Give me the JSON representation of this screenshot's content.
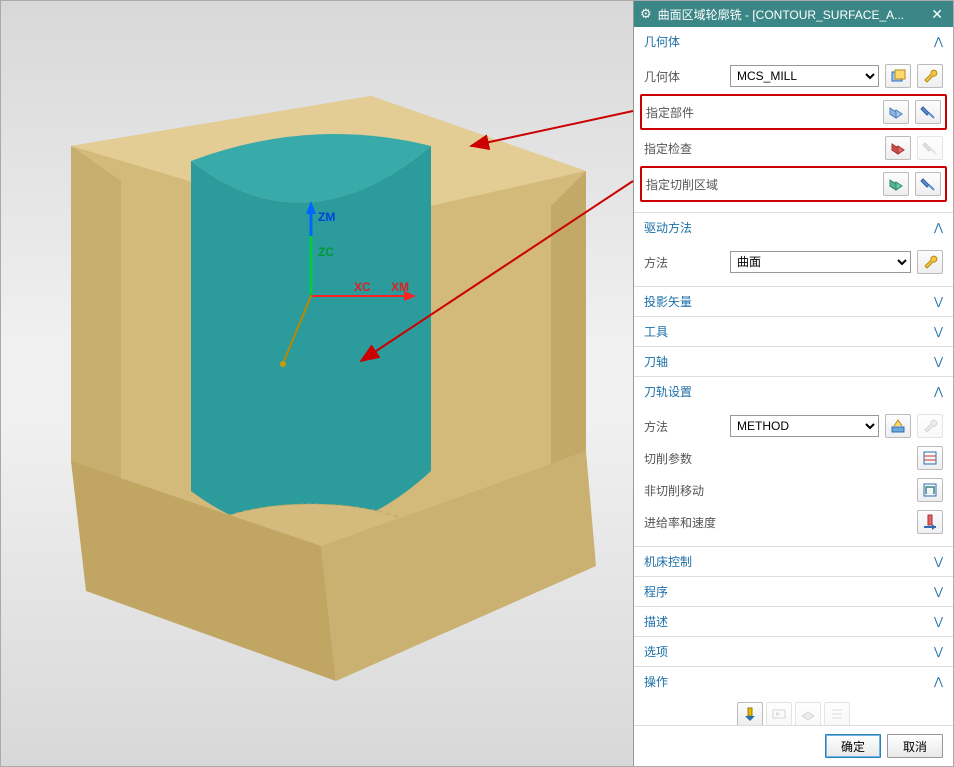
{
  "dialog": {
    "title": "曲面区域轮廓铣 - [CONTOUR_SURFACE_A...",
    "close": "✕"
  },
  "geometry": {
    "header": "几何体",
    "body_label": "几何体",
    "body_value": "MCS_MILL",
    "specify_part": "指定部件",
    "specify_check": "指定检查",
    "specify_cut_area": "指定切削区域"
  },
  "drive": {
    "header": "驱动方法",
    "method_label": "方法",
    "method_value": "曲面"
  },
  "projection": {
    "header": "投影矢量"
  },
  "tool": {
    "header": "工具"
  },
  "tool_axis": {
    "header": "刀轴"
  },
  "toolpath": {
    "header": "刀轨设置",
    "method_label": "方法",
    "method_value": "METHOD",
    "cut_params": "切削参数",
    "noncut_moves": "非切削移动",
    "feed_speed": "进给率和速度"
  },
  "machine_control": {
    "header": "机床控制"
  },
  "program": {
    "header": "程序"
  },
  "description": {
    "header": "描述"
  },
  "options": {
    "header": "选项"
  },
  "actions": {
    "header": "操作"
  },
  "footer": {
    "ok": "确定",
    "cancel": "取消"
  },
  "axes": {
    "z1": "ZM",
    "z2": "ZC",
    "x1": "XC",
    "x2": "XM"
  }
}
